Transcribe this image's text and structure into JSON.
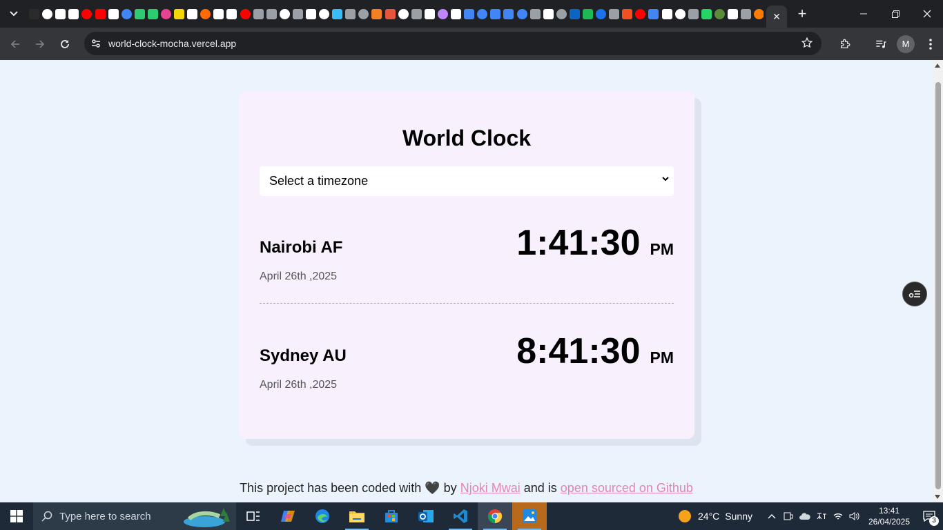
{
  "browser": {
    "url": "world-clock-mocha.vercel.app",
    "tab_close": "✕",
    "new_tab": "+",
    "profile_initial": "M",
    "favicon_colors": [
      "#2b2b2b",
      "#ffffff",
      "#ffffff",
      "#ffffff",
      "#ff0000",
      "#ff0000",
      "#ffffff",
      "#4285f4",
      "#2ecc71",
      "#2ecc71",
      "#e84393",
      "#f5d60a",
      "#ffffff",
      "#ff6b00",
      "#ffffff",
      "#ffffff",
      "#ff0000",
      "#9aa0a6",
      "#9aa0a6",
      "#ffffff",
      "#9aa0a6",
      "#ffffff",
      "#ffffff",
      "#38bdf8",
      "#9aa0a6",
      "#9aa0a6",
      "#f48024",
      "#e8553d",
      "#ffffff",
      "#9aa0a6",
      "#ffffff",
      "#c084fc",
      "#ffffff",
      "#4285f4",
      "#4285f4",
      "#4285f4",
      "#4285f4",
      "#4285f4",
      "#9aa0a6",
      "#ffffff",
      "#9aa0a6",
      "#0a66c2",
      "#1db954",
      "#1a73e8",
      "#9aa0a6",
      "#f25022",
      "#ff0000",
      "#4285f4",
      "#ffffff",
      "#ffffff",
      "#9aa0a6",
      "#25d366",
      "#5b8c3a",
      "#ffffff",
      "#9aa0a6",
      "#ff7b00"
    ]
  },
  "page": {
    "title": "World Clock",
    "select": {
      "selected": "Select a timezone"
    },
    "cities": [
      {
        "name": "Nairobi AF",
        "date": "April 26th ,2025",
        "time": "1:41:30",
        "ampm": "PM"
      },
      {
        "name": "Sydney AU",
        "date": "April 26th ,2025",
        "time": "8:41:30",
        "ampm": "PM"
      }
    ],
    "footer": {
      "prefix": "This project has been coded with",
      "heart": "🖤",
      "by": "by",
      "author": "Njoki Mwai",
      "middle": "and is",
      "repo_link": "open sourced on Github"
    }
  },
  "taskbar": {
    "search_placeholder": "Type here to search",
    "weather": {
      "temp": "24°C",
      "condition": "Sunny"
    },
    "time": "13:41",
    "date": "26/04/2025",
    "notification_count": "3",
    "apps": [
      "task-view",
      "copilot",
      "edge",
      "file-explorer",
      "microsoft-store",
      "outlook",
      "vscode",
      "chrome",
      "paint"
    ]
  },
  "colors": {
    "page_bg": "#ebf4fd",
    "card_bg": "#f8f1fd",
    "link": "#e683b7",
    "chrome_dark": "#202124",
    "taskbar": "#1f2a38"
  }
}
